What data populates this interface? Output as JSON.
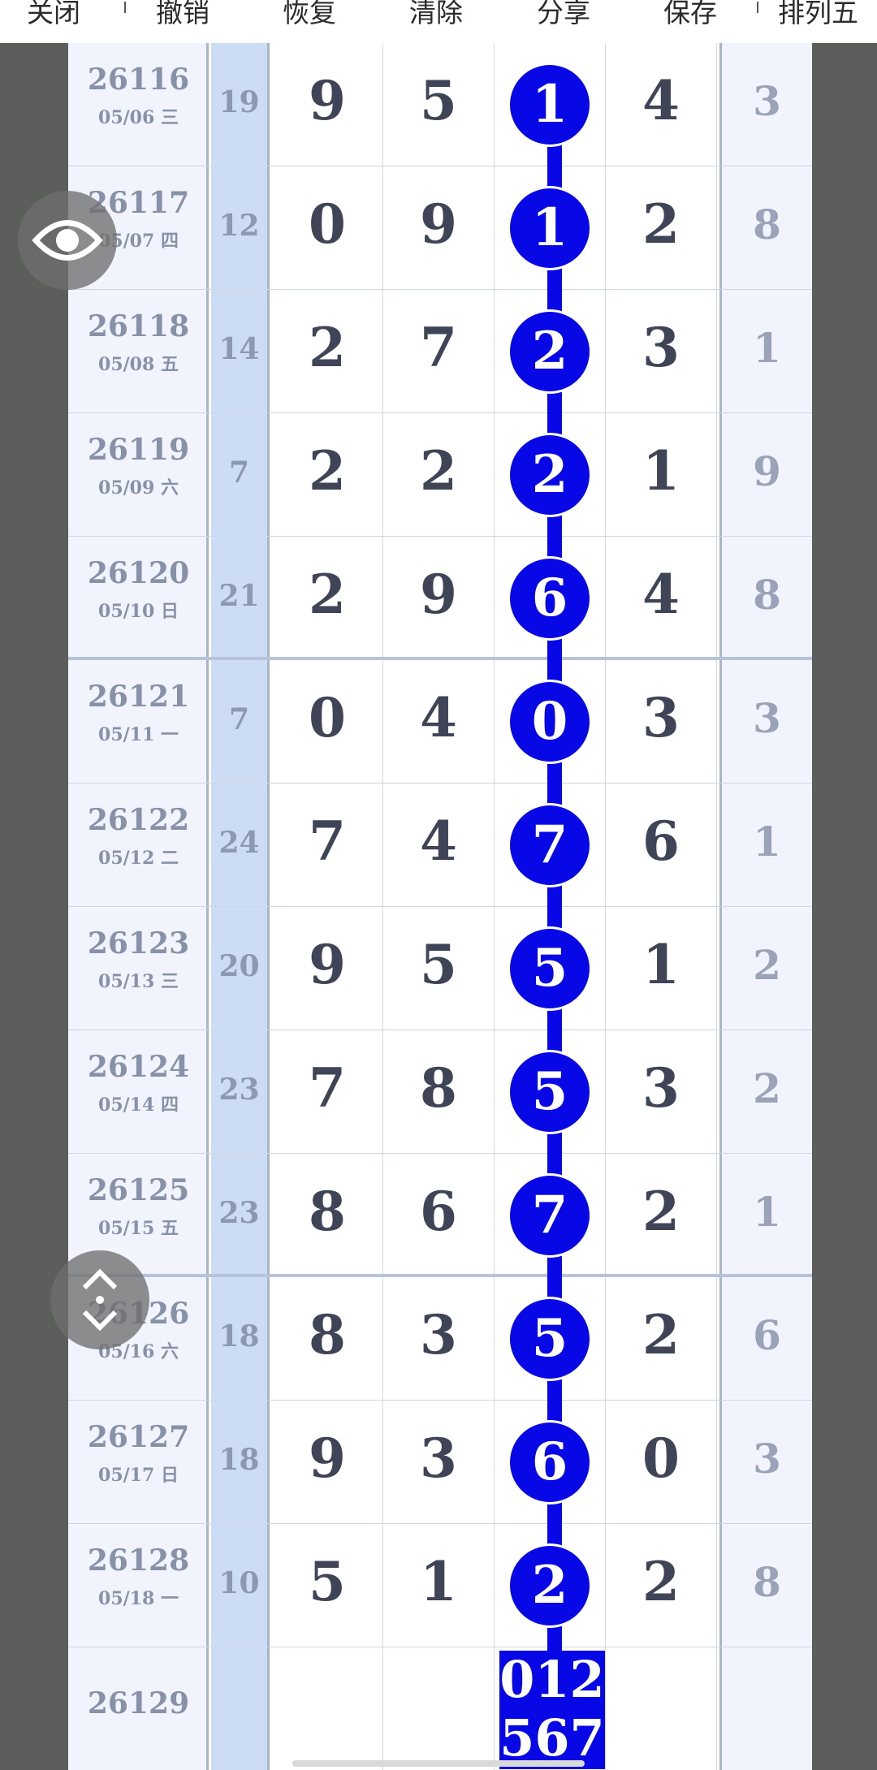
{
  "toolbar": {
    "close": "关闭",
    "undo": "撤销",
    "redo": "恢复",
    "clear": "清除",
    "share": "分享",
    "save": "保存",
    "lottery": "排列五"
  },
  "rows": [
    {
      "issue": "26116",
      "date": "05/06 三",
      "sum": "19",
      "d1": "9",
      "d2": "5",
      "d3": "1",
      "d4": "4",
      "d5": "3"
    },
    {
      "issue": "26117",
      "date": "05/07 四",
      "sum": "12",
      "d1": "0",
      "d2": "9",
      "d3": "1",
      "d4": "2",
      "d5": "8"
    },
    {
      "issue": "26118",
      "date": "05/08 五",
      "sum": "14",
      "d1": "2",
      "d2": "7",
      "d3": "2",
      "d4": "3",
      "d5": "1"
    },
    {
      "issue": "26119",
      "date": "05/09 六",
      "sum": "7",
      "d1": "2",
      "d2": "2",
      "d3": "2",
      "d4": "1",
      "d5": "9"
    },
    {
      "issue": "26120",
      "date": "05/10 日",
      "sum": "21",
      "d1": "2",
      "d2": "9",
      "d3": "6",
      "d4": "4",
      "d5": "8"
    },
    {
      "issue": "26121",
      "date": "05/11 一",
      "sum": "7",
      "d1": "0",
      "d2": "4",
      "d3": "0",
      "d4": "3",
      "d5": "3"
    },
    {
      "issue": "26122",
      "date": "05/12 二",
      "sum": "24",
      "d1": "7",
      "d2": "4",
      "d3": "7",
      "d4": "6",
      "d5": "1"
    },
    {
      "issue": "26123",
      "date": "05/13 三",
      "sum": "20",
      "d1": "9",
      "d2": "5",
      "d3": "5",
      "d4": "1",
      "d5": "2"
    },
    {
      "issue": "26124",
      "date": "05/14 四",
      "sum": "23",
      "d1": "7",
      "d2": "8",
      "d3": "5",
      "d4": "3",
      "d5": "2"
    },
    {
      "issue": "26125",
      "date": "05/15 五",
      "sum": "23",
      "d1": "8",
      "d2": "6",
      "d3": "7",
      "d4": "2",
      "d5": "1"
    },
    {
      "issue": "26126",
      "date": "05/16 六",
      "sum": "18",
      "d1": "8",
      "d2": "3",
      "d3": "5",
      "d4": "2",
      "d5": "6"
    },
    {
      "issue": "26127",
      "date": "05/17 日",
      "sum": "18",
      "d1": "9",
      "d2": "3",
      "d3": "6",
      "d4": "0",
      "d5": "3"
    },
    {
      "issue": "26128",
      "date": "05/18 一",
      "sum": "10",
      "d1": "5",
      "d2": "1",
      "d3": "2",
      "d4": "2",
      "d5": "8"
    }
  ],
  "next_issue": {
    "issue": "26129",
    "prediction_line1": "012",
    "prediction_line2": "567"
  },
  "colors": {
    "highlight_ball": "#0808e6",
    "page_bg": "#5c5e5c",
    "sum_column": "#cddcf5"
  },
  "icons": {
    "eye": "eye-icon",
    "scroll": "up-down-chevron-icon"
  }
}
